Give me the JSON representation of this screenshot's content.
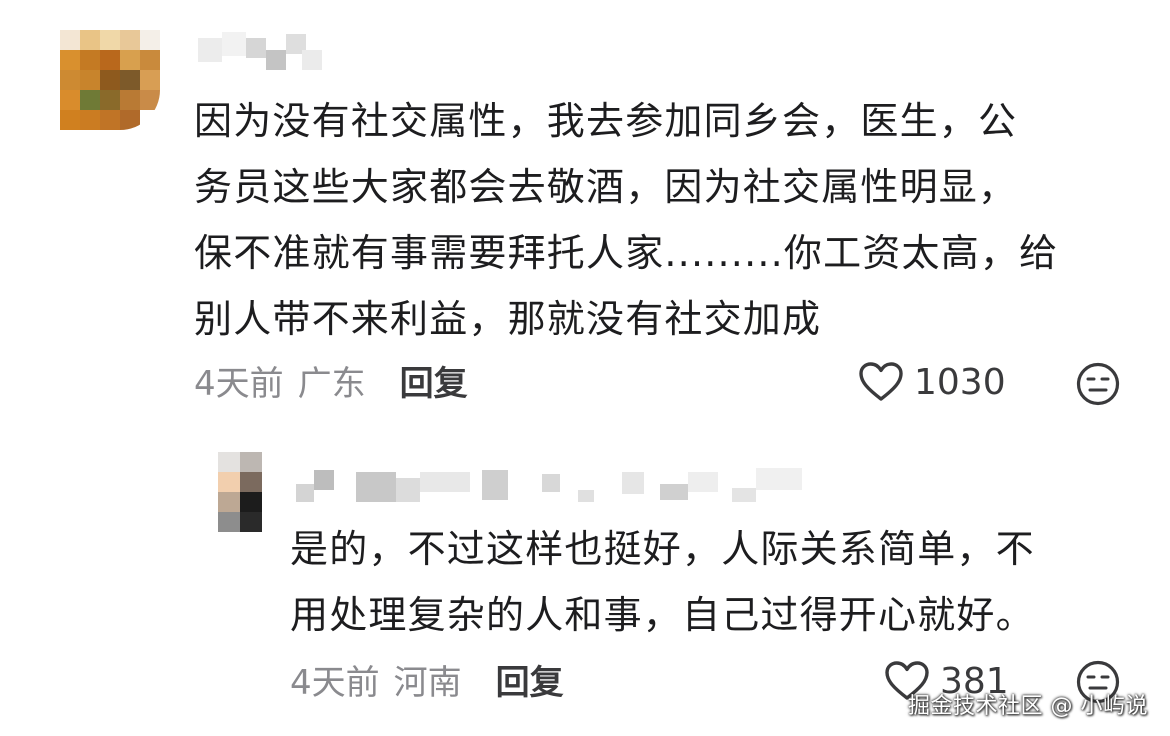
{
  "comments": [
    {
      "text": "因为没有社交属性，我去参加同乡会，医生，公\n务员这些大家都会去敬酒，因为社交属性明显，\n保不准就有事需要拜托人家.........你工资太高，给\n别人带不来利益，那就没有社交加成",
      "time": "4天前",
      "region": "广东",
      "reply_label": "回复",
      "likes": "1030",
      "like_icon": "heart-outline-icon",
      "reaction_icon": "neutral-face-icon"
    },
    {
      "text": "是的，不过这样也挺好，人际关系简单，不\n用处理复杂的人和事，自己过得开心就好。",
      "time": "4天前",
      "region": "河南",
      "reply_label": "回复",
      "likes": "381",
      "like_icon": "heart-outline-icon",
      "reaction_icon": "neutral-face-icon"
    }
  ],
  "watermark": "掘金技术社区 @ 小屿说",
  "colors": {
    "text": "#1d1d1f",
    "meta": "#8a8a8e",
    "icon": "#3a3a3c",
    "background": "#ffffff"
  }
}
